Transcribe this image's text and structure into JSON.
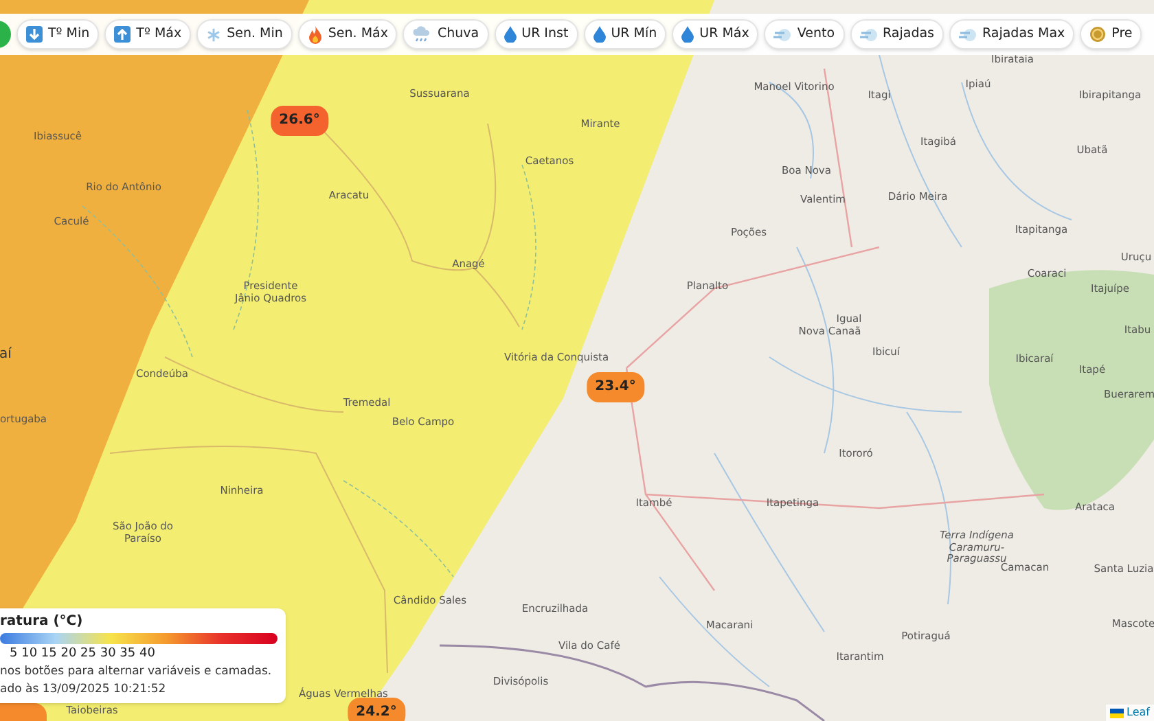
{
  "toolbar": {
    "buttons": [
      {
        "kind": "tmin",
        "label": "Tº Min"
      },
      {
        "kind": "tmax",
        "label": "Tº Máx"
      },
      {
        "kind": "snow",
        "label": "Sen. Min"
      },
      {
        "kind": "fire",
        "label": "Sen. Máx"
      },
      {
        "kind": "rain",
        "label": "Chuva"
      },
      {
        "kind": "drop",
        "label": "UR Inst"
      },
      {
        "kind": "drop",
        "label": "UR Mín"
      },
      {
        "kind": "drop",
        "label": "UR Máx"
      },
      {
        "kind": "wind",
        "label": "Vento"
      },
      {
        "kind": "wind",
        "label": "Rajadas"
      },
      {
        "kind": "wind",
        "label": "Rajadas Max"
      },
      {
        "kind": "coin",
        "label": "Pre"
      }
    ]
  },
  "map": {
    "places": [
      "Ibirataia",
      "Sussuarana",
      "Manoel Vitorino",
      "Itagi",
      "Ipiaú",
      "Ibirapitanga",
      "Ibiassucê",
      "Mirante",
      "Caetanos",
      "Boa Nova",
      "Itagibá",
      "Ubatã",
      "Rio do Antônio",
      "Aracatu",
      "Valentim",
      "Dário Meira",
      "Caculé",
      "Poções",
      "Itapitanga",
      "Uruçu",
      "Presidente\nJânio Quadros",
      "Anagé",
      "Coaraci",
      "Planalto",
      "Itajuípe",
      "Igual",
      "Itabu",
      "Nova Canaã",
      "aí",
      "Vitória da Conquista",
      "Ibicuí",
      "Ibicaraí",
      "Condeúba",
      "Itapé",
      "Buerarem",
      "Tremedal",
      "ortugaba",
      "Belo Campo",
      "Itororó",
      "Itambé",
      "Itapetinga",
      "Arataca",
      "Ninheira",
      "São João do\nParaíso",
      "Terra Indígena\nCaramuru-\nParaguassu",
      "Camacan",
      "Santa Luzia",
      "Cândido Sales",
      "Encruzilhada",
      "Macarani",
      "Mascote",
      "Vila do Café",
      "Potiraguá",
      "Itarantim",
      "Divisópolis",
      "Águas Vermelhas",
      "Taiobeiras"
    ],
    "markers": [
      {
        "label": "26.6°",
        "color": "#f4622e"
      },
      {
        "label": "23.4°",
        "color": "#f58a2c"
      },
      {
        "label": "24.2°",
        "color": "#f58a2c"
      }
    ],
    "attribution": "Leaf"
  },
  "legend": {
    "title": "ratura (°C)",
    "scale": "5 10 15 20 25 30 35 40",
    "hint": "nos botões para alternar variáveis e camadas.",
    "updated": "ado às 13/09/2025 10:21:52"
  }
}
